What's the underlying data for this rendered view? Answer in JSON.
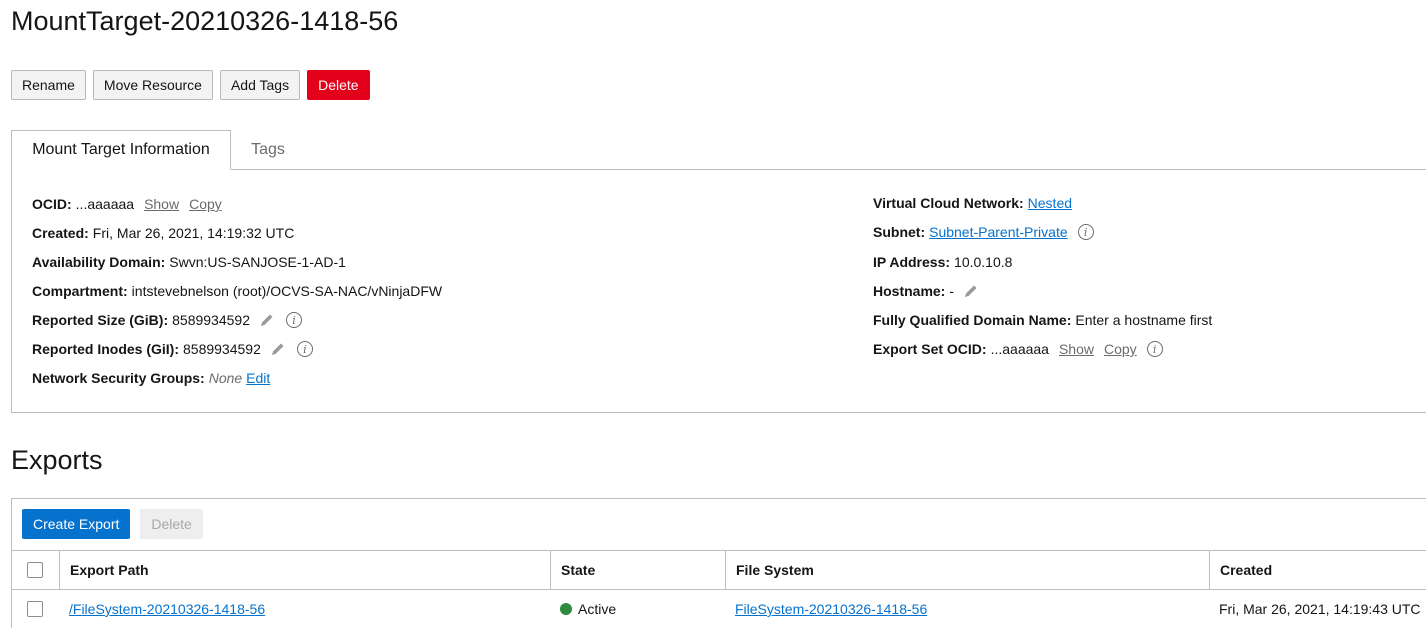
{
  "page": {
    "title": "MountTarget-20210326-1418-56"
  },
  "actions": {
    "rename": "Rename",
    "move": "Move Resource",
    "add_tags": "Add Tags",
    "delete": "Delete"
  },
  "tabs": [
    {
      "label": "Mount Target Information"
    },
    {
      "label": "Tags"
    }
  ],
  "info": {
    "ocid": {
      "label": "OCID:",
      "value": "...aaaaaa",
      "show": "Show",
      "copy": "Copy"
    },
    "created": {
      "label": "Created:",
      "value": "Fri, Mar 26, 2021, 14:19:32 UTC"
    },
    "availability_domain": {
      "label": "Availability Domain:",
      "value": "Swvn:US-SANJOSE-1-AD-1"
    },
    "compartment": {
      "label": "Compartment:",
      "value": "intstevebnelson (root)/OCVS-SA-NAC/vNinjaDFW"
    },
    "reported_size": {
      "label": "Reported Size (GiB):",
      "value": "8589934592"
    },
    "reported_inodes": {
      "label": "Reported Inodes (GiI):",
      "value": "8589934592"
    },
    "nsg": {
      "label": "Network Security Groups:",
      "value": "None",
      "edit": "Edit"
    },
    "vcn": {
      "label": "Virtual Cloud Network:",
      "value": "Nested"
    },
    "subnet": {
      "label": "Subnet:",
      "value": "Subnet-Parent-Private"
    },
    "ip_address": {
      "label": "IP Address:",
      "value": "10.0.10.8"
    },
    "hostname": {
      "label": "Hostname:",
      "value": "-"
    },
    "fqdn": {
      "label": "Fully Qualified Domain Name:",
      "value": "Enter a hostname first"
    },
    "export_set_ocid": {
      "label": "Export Set OCID:",
      "value": "...aaaaaa",
      "show": "Show",
      "copy": "Copy"
    }
  },
  "exports": {
    "title": "Exports",
    "create": "Create Export",
    "delete": "Delete",
    "columns": {
      "path": "Export Path",
      "state": "State",
      "fs": "File System",
      "created": "Created"
    },
    "rows": [
      {
        "path": "/FileSystem-20210326-1418-56",
        "state": "Active",
        "fs": "FileSystem-20210326-1418-56",
        "created": "Fri, Mar 26, 2021, 14:19:43 UTC"
      }
    ]
  },
  "colors": {
    "accent": "#0572ce",
    "danger": "#e2001a",
    "active": "#2d8a3e"
  },
  "icons": {
    "edit": "pencil-icon",
    "info": "info-icon",
    "status": "status-dot-icon"
  }
}
